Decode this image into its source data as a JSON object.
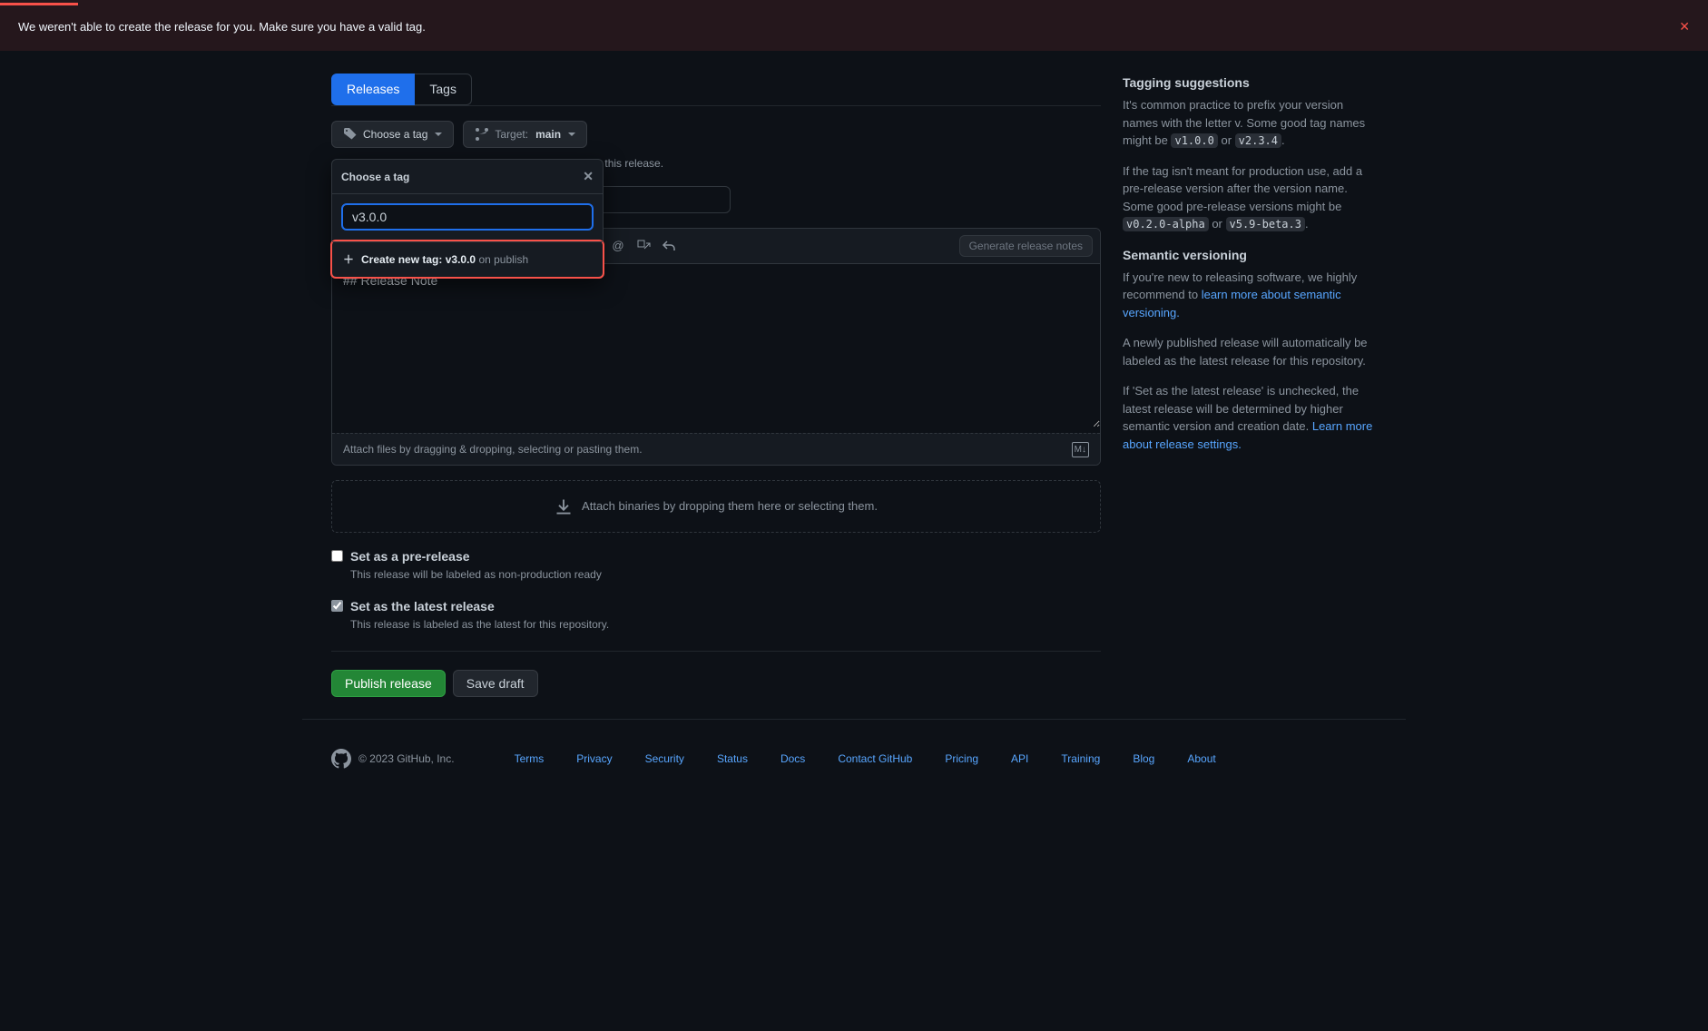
{
  "error": {
    "message": "We weren't able to create the release for you. Make sure you have a valid tag.",
    "close": "✕"
  },
  "tabs": {
    "releases": "Releases",
    "tags": "Tags"
  },
  "tag_button": "Choose a tag",
  "target": {
    "label": "Target:",
    "branch": "main"
  },
  "hint_after_tag": "publish this release.",
  "popover": {
    "title": "Choose a tag",
    "input_value": "v3.0.0",
    "create_prefix": "Create new tag:",
    "create_tag": "v3.0.0",
    "create_suffix": "on publish"
  },
  "title_placeholder": "",
  "toolbar": {
    "generate": "Generate release notes"
  },
  "editor_value": "## Release Note",
  "attach_hint": "Attach files by dragging & dropping, selecting or pasting them.",
  "md_badge": "M↓",
  "binaries_hint": "Attach binaries by dropping them here or selecting them.",
  "prerelease": {
    "label": "Set as a pre-release",
    "desc": "This release will be labeled as non-production ready"
  },
  "latest": {
    "label": "Set as the latest release",
    "desc": "This release is labeled as the latest for this repository."
  },
  "actions": {
    "publish": "Publish release",
    "draft": "Save draft"
  },
  "sidebar": {
    "tagging_title": "Tagging suggestions",
    "tagging_p1a": "It's common practice to prefix your version names with the letter v. Some good tag names might be ",
    "tagging_code1": "v1.0.0",
    "tagging_or": " or ",
    "tagging_code2": "v2.3.4",
    "tagging_p2a": "If the tag isn't meant for production use, add a pre-release version after the version name. Some good pre-release versions might be ",
    "tagging_code3": "v0.2.0-alpha",
    "tagging_code4": "v5.9-beta.3",
    "semver_title": "Semantic versioning",
    "semver_p1": "If you're new to releasing software, we highly recommend to ",
    "semver_link": "learn more about semantic versioning.",
    "semver_p2": "A newly published release will automatically be labeled as the latest release for this repository.",
    "semver_p3": "If 'Set as the latest release' is unchecked, the latest release will be determined by higher semantic version and creation date. ",
    "semver_link2": "Learn more about release settings."
  },
  "footer": {
    "copyright": "© 2023 GitHub, Inc.",
    "links": [
      "Terms",
      "Privacy",
      "Security",
      "Status",
      "Docs",
      "Contact GitHub",
      "Pricing",
      "API",
      "Training",
      "Blog",
      "About"
    ]
  }
}
